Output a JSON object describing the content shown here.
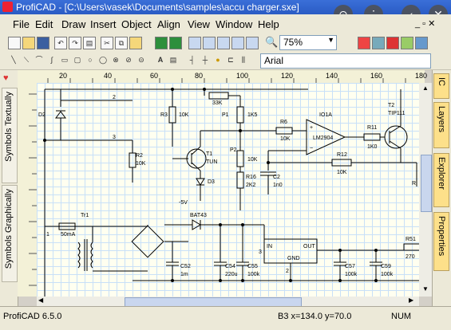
{
  "window": {
    "title": "ProfiCAD - [C:\\Users\\vasek\\Documents\\samples\\accu charger.sxe]"
  },
  "overlay": {
    "icons": [
      "search-icon",
      "more-icon",
      "back-icon",
      "close-icon"
    ]
  },
  "menu": {
    "items": [
      "File",
      "Edit",
      "Draw",
      "Insert",
      "Object",
      "Align",
      "View",
      "Window",
      "Help"
    ]
  },
  "toolbar": {
    "zoom": "75%",
    "font": "Arial"
  },
  "left_tabs": [
    "Symbols Textually",
    "Symbols Graphically"
  ],
  "right_tabs": [
    "IC",
    "Layers",
    "Explorer",
    "Properties"
  ],
  "ruler": {
    "ticks": [
      "20",
      "40",
      "60",
      "80",
      "100",
      "120",
      "140",
      "160",
      "180"
    ]
  },
  "schematic": {
    "labels": {
      "d2": "D2",
      "n2": "2",
      "n3": "3",
      "r3": "R3",
      "r3v": "10K",
      "r2": "R2",
      "r2v": "10K",
      "t1": "T1",
      "t1v": "TUN",
      "d3": "D3",
      "m5v": "-5V",
      "k33": "33K",
      "p1": "P1",
      "p1v": "1K5",
      "p2": "P2",
      "p2v": "10K",
      "r16": "R16",
      "r16v": "2K2",
      "r6": "R6",
      "r6v": "10K",
      "c2": "C2",
      "c2v": "1n0",
      "io1a": "IO1A",
      "plus": "+",
      "minus": "−",
      "lm": "LM2904",
      "r11": "R11",
      "r11v": "1K0",
      "r12": "R12",
      "r12v": "10K",
      "t2": "T2",
      "t2v": "TIP111",
      "rr": "R",
      "tr1": "Tr1",
      "in1": "1",
      "ma": "50mA",
      "bat": "BAT43",
      "c52": "C52",
      "c52v": "1m",
      "c54": "C54",
      "c54v": "220u",
      "c55": "C55",
      "c55v": "100k",
      "in": "IN",
      "gnd": "GND",
      "out": "OUT",
      "n3b": "3",
      "n2b": "2",
      "c57": "C57",
      "c57v": "100k",
      "c59": "C59",
      "c59v": "100k",
      "r51": "R51",
      "r51v": "270"
    }
  },
  "status": {
    "version": "ProfiCAD 6.5.0",
    "position": "B3  x=134.0  y=70.0",
    "mode": "NUM"
  }
}
